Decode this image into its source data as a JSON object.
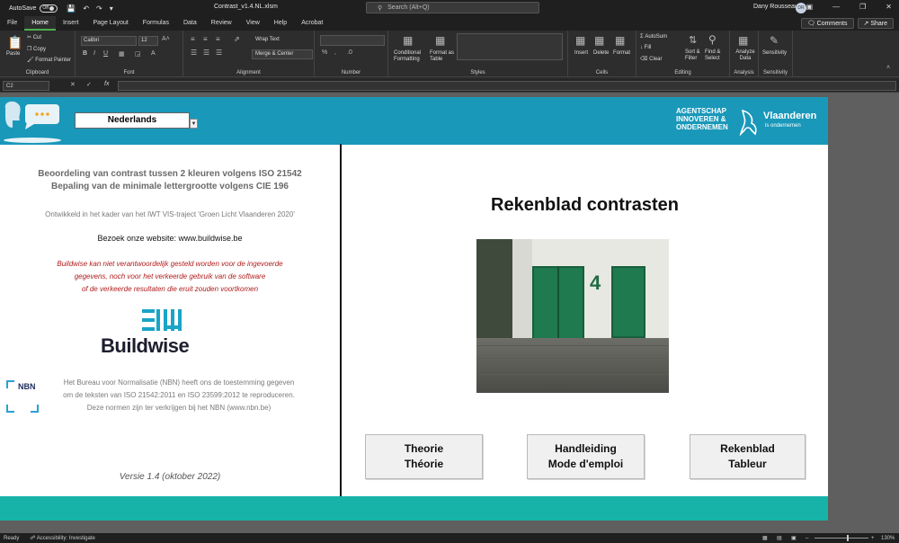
{
  "titlebar": {
    "autosave_label": "AutoSave",
    "autosave_state": "Off",
    "document_title": "Contrast_v1.4.NL.xlsm",
    "search_placeholder": "Search (Alt+Q)",
    "user_name": "Dany Rousseau",
    "user_initials": "DR"
  },
  "menu": {
    "tabs": [
      "File",
      "Home",
      "Insert",
      "Page Layout",
      "Formulas",
      "Data",
      "Review",
      "View",
      "Help",
      "Acrobat"
    ],
    "active_tab": "Home",
    "comments_label": "Comments",
    "share_label": "Share"
  },
  "ribbon": {
    "clipboard": {
      "label": "Clipboard",
      "paste": "Paste",
      "cut": "Cut",
      "copy": "Copy",
      "format_painter": "Format Painter"
    },
    "font": {
      "label": "Font",
      "font_name": "Calibri",
      "font_size": "12"
    },
    "alignment": {
      "label": "Alignment",
      "wrap_text": "Wrap Text",
      "merge_center": "Merge & Center"
    },
    "number": {
      "label": "Number"
    },
    "styles": {
      "label": "Styles",
      "conditional_formatting": "Conditional Formatting",
      "format_as_table": "Format as Table"
    },
    "cells": {
      "label": "Cells",
      "insert": "Insert",
      "delete": "Delete",
      "format": "Format"
    },
    "editing": {
      "label": "Editing",
      "autosum": "AutoSum",
      "fill": "Fill",
      "clear": "Clear",
      "sort_filter": "Sort & Filter",
      "find_select": "Find & Select"
    },
    "analysis": {
      "label": "Analysis",
      "analyze_data": "Analyze Data"
    },
    "sensitivity": {
      "label": "Sensitivity",
      "sensitivity": "Sensitivity"
    }
  },
  "formula_bar": {
    "name_box": "C2",
    "fx": "fx",
    "value": ""
  },
  "sheet": {
    "language_selected": "Nederlands",
    "agency_lines": [
      "AGENTSCHAP",
      "INNOVEREN &",
      "ONDERNEMEN"
    ],
    "vlaanderen_name": "Vlaanderen",
    "vlaanderen_sub": "is ondernemen",
    "left_title_1": "Beoordeling van contrast tussen 2 kleuren volgens ISO 21542",
    "left_title_2": "Bepaling van de minimale lettergrootte volgens CIE 196",
    "developed": "Ontwikkeld in het kader van het IWT VIS-traject 'Groen Licht Vlaanderen 2020'",
    "website": "Bezoek onze website: www.buildwise.be",
    "disclaimer": [
      "Buildwise kan niet verantwoordelijk gesteld worden voor de ingevoerde",
      "gegevens, noch voor het verkeerde gebruik van de software",
      "of de verkeerde resultaten die eruit zouden voortkomen"
    ],
    "buildwise_name": "Buildwise",
    "nbn_label": "NBN",
    "nbn_text": [
      "Het Bureau voor Normalisatie (NBN) heeft ons de toestemming gegeven",
      "om de teksten van ISO 21542:2011 en ISO 23599:2012 te reproduceren.",
      "Deze normen zijn ter verkrijgen bij het NBN (www.nbn.be)"
    ],
    "version": "Versie 1.4 (oktober 2022)",
    "main_title": "Rekenblad contrasten",
    "photo_number": "4",
    "buttons": [
      {
        "line1": "Theorie",
        "line2": "Théorie"
      },
      {
        "line1": "Handleiding",
        "line2": "Mode d'emploi"
      },
      {
        "line1": "Rekenblad",
        "line2": "Tableur"
      }
    ]
  },
  "status": {
    "ready": "Ready",
    "accessibility": "Accessibility: Investigate",
    "zoom": "130%"
  },
  "colors": {
    "header": "#1a98b9",
    "footer": "#17b3a9",
    "disclaimer": "#b01c1c"
  }
}
